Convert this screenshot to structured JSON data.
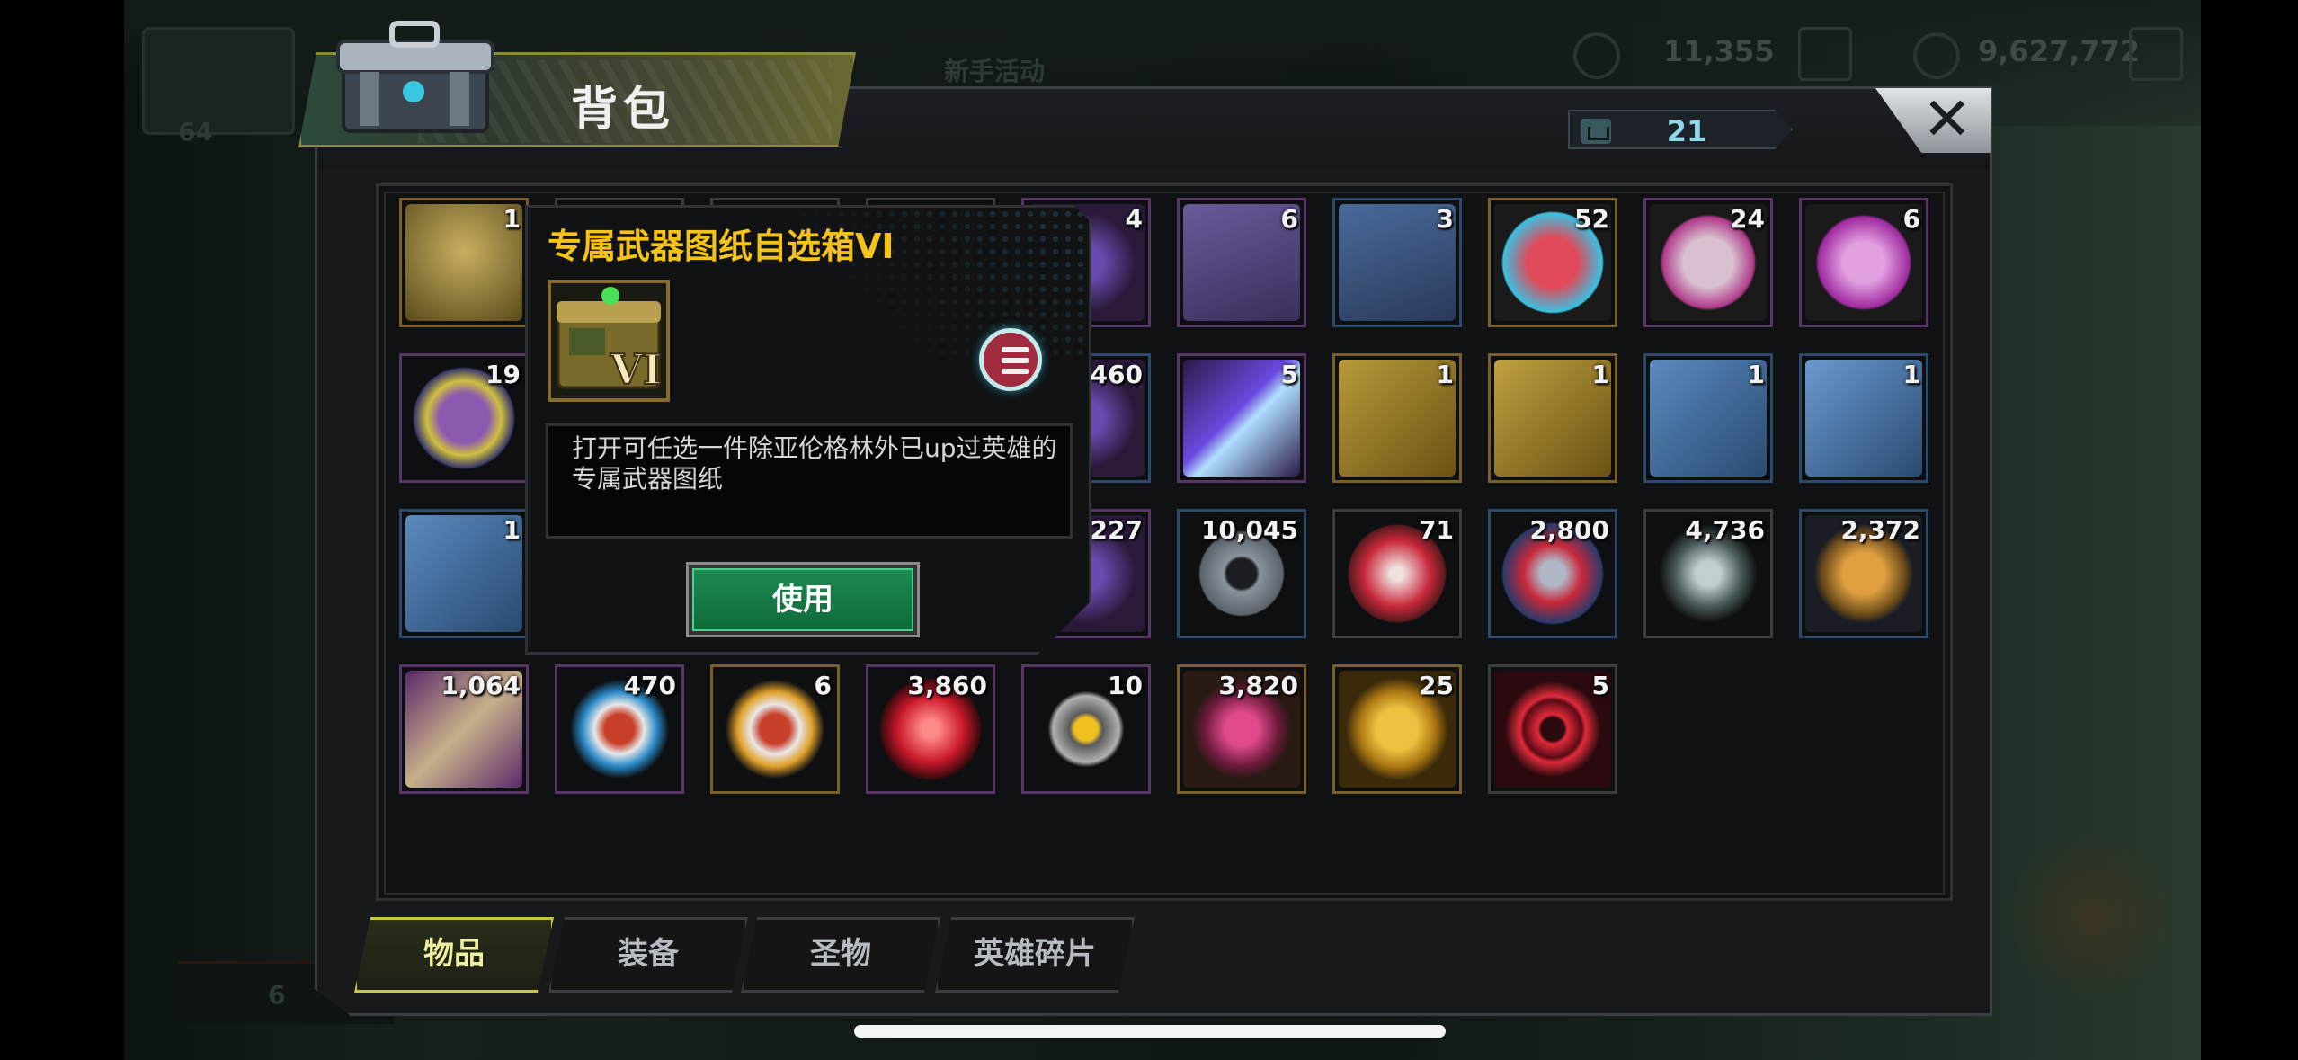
{
  "background": {
    "res1": "11,355",
    "res2": "9,627,772",
    "level": "64",
    "event_text": "新手活动",
    "bottom_left_count": "6"
  },
  "window": {
    "title": "背包",
    "capacity": "21",
    "close_icon": "close-icon"
  },
  "items": [
    {
      "qty": "1",
      "art": "chest-vi-icon",
      "quality": "gold"
    },
    {
      "qty": "",
      "art": "hidden",
      "quality": "grey"
    },
    {
      "qty": "",
      "art": "hidden",
      "quality": "grey"
    },
    {
      "qty": "",
      "art": "hidden",
      "quality": "grey"
    },
    {
      "qty": "4",
      "art": "item-icon",
      "quality": "purple"
    },
    {
      "qty": "6",
      "art": "speedup-12h-icon",
      "quality": "purple"
    },
    {
      "qty": "3",
      "art": "speedup-4h-icon",
      "quality": "blue"
    },
    {
      "qty": "52",
      "art": "bottle-cap-red-icon",
      "quality": "gold"
    },
    {
      "qty": "24",
      "art": "film-reel-icon",
      "quality": "purple"
    },
    {
      "qty": "6",
      "art": "bottle-cap-purple-icon",
      "quality": "purple"
    },
    {
      "qty": "19",
      "art": "poker-chip-icon",
      "quality": "purple"
    },
    {
      "qty": "",
      "art": "hidden",
      "quality": "grey"
    },
    {
      "qty": "",
      "art": "hidden",
      "quality": "grey"
    },
    {
      "qty": "",
      "art": "hidden",
      "quality": "grey"
    },
    {
      "qty": "460",
      "art": "item-icon",
      "quality": "blue"
    },
    {
      "qty": "5",
      "art": "crystal-icon",
      "quality": "purple"
    },
    {
      "qty": "1",
      "art": "blueprint-armor-icon",
      "quality": "gold"
    },
    {
      "qty": "1",
      "art": "blueprint-weapon-icon",
      "quality": "gold"
    },
    {
      "qty": "1",
      "art": "blueprint-boots-icon",
      "quality": "blue"
    },
    {
      "qty": "1",
      "art": "blueprint-shirt-icon",
      "quality": "blue"
    },
    {
      "qty": "1",
      "art": "blueprint-gloves-icon",
      "quality": "blue"
    },
    {
      "qty": "",
      "art": "hidden",
      "quality": "grey"
    },
    {
      "qty": "",
      "art": "hidden",
      "quality": "grey"
    },
    {
      "qty": "",
      "art": "hidden",
      "quality": "grey"
    },
    {
      "qty": "227",
      "art": "item-icon",
      "quality": "purple"
    },
    {
      "qty": "10,045",
      "art": "gear-icon",
      "quality": "blue"
    },
    {
      "qty": "71",
      "art": "red-node-icon",
      "quality": "grey"
    },
    {
      "qty": "2,800",
      "art": "eye-emblem-icon",
      "quality": "blue"
    },
    {
      "qty": "4,736",
      "art": "triangle-shard-icon",
      "quality": "grey"
    },
    {
      "qty": "2,372",
      "art": "fist-icon",
      "quality": "blue"
    },
    {
      "qty": "1,064",
      "art": "puzzle-icon",
      "quality": "purple"
    },
    {
      "qty": "470",
      "art": "tank-badge-blue-icon",
      "quality": "purple"
    },
    {
      "qty": "6",
      "art": "tank-badge-gold-icon",
      "quality": "gold"
    },
    {
      "qty": "3,860",
      "art": "red-gem-icon",
      "quality": "purple"
    },
    {
      "qty": "10",
      "art": "lightning-coin-icon",
      "quality": "purple"
    },
    {
      "qty": "3,820",
      "art": "ore-icon",
      "quality": "gold"
    },
    {
      "qty": "25",
      "art": "gold-coins-icon",
      "quality": "gold"
    },
    {
      "qty": "5",
      "art": "red-target-icon",
      "quality": "grey"
    }
  ],
  "tooltip": {
    "title": "专属武器图纸自选箱VI",
    "icon": "chest-vi-icon",
    "numeral": "VI",
    "description": "打开可任选一件除亚伦格林外已up过英雄的专属武器图纸",
    "use_label": "使用",
    "list_icon": "list-icon"
  },
  "tabs": [
    {
      "label": "物品",
      "active": true
    },
    {
      "label": "装备",
      "active": false
    },
    {
      "label": "圣物",
      "active": false
    },
    {
      "label": "英雄碎片",
      "active": false
    }
  ],
  "colors": {
    "accent_gold": "#f5c21a",
    "use_button": "#1e8a52",
    "capacity_text": "#8fd9ea",
    "active_tab": "#c8c83a"
  }
}
